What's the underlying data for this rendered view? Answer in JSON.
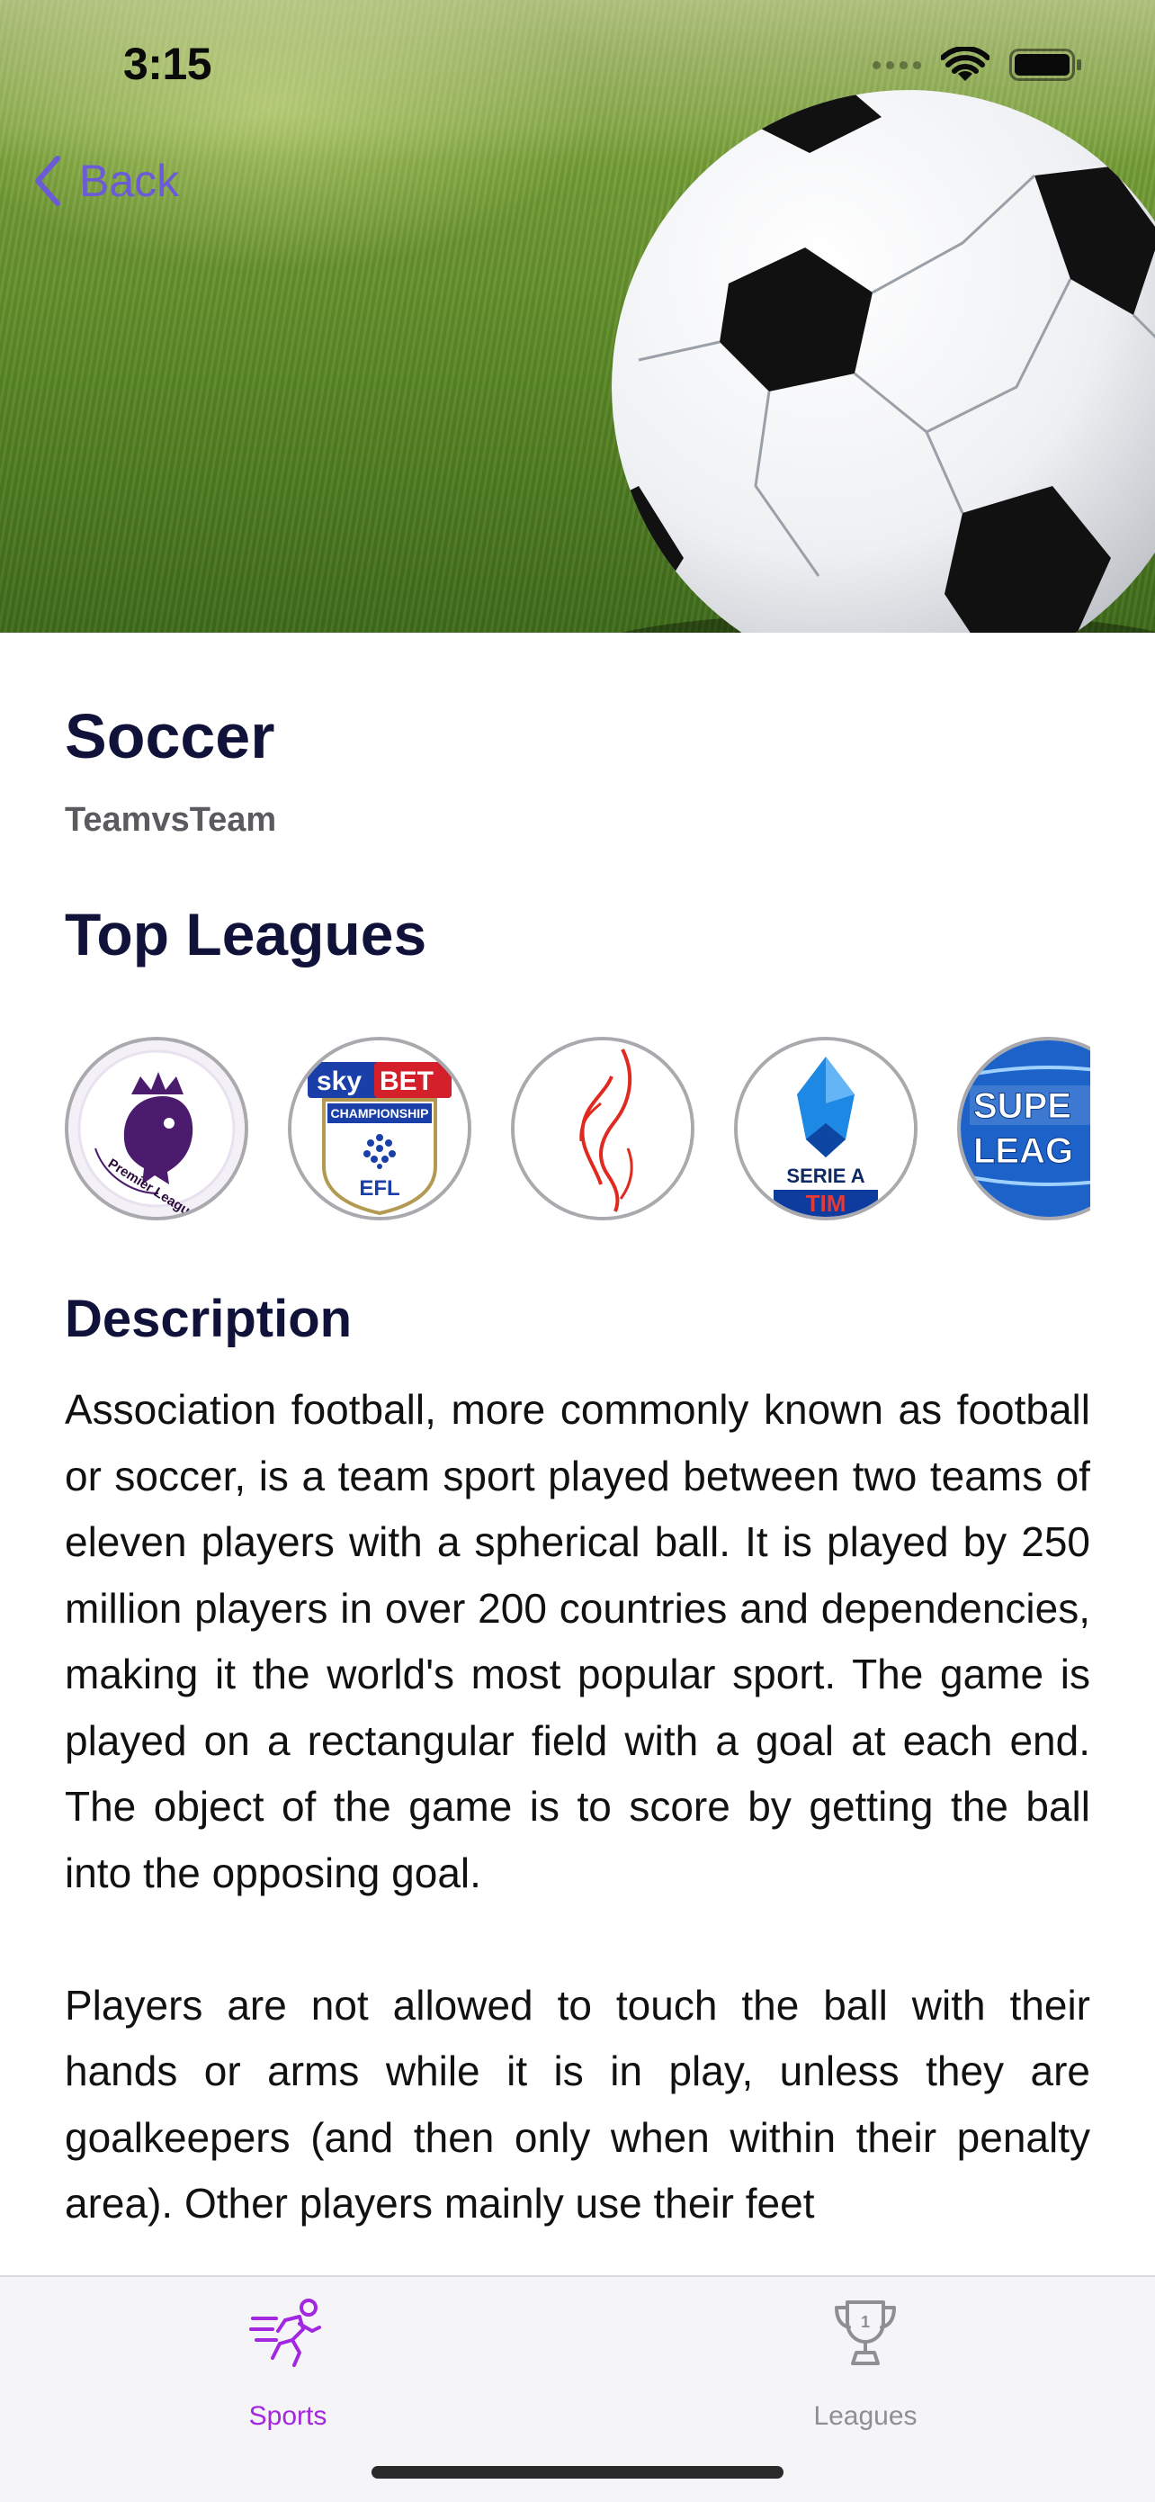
{
  "status_bar": {
    "time": "3:15"
  },
  "nav": {
    "back_label": "Back",
    "accent_color": "#6b5bd6"
  },
  "sport": {
    "name": "Soccer",
    "format": "TeamvsTeam"
  },
  "top_leagues": {
    "heading": "Top Leagues",
    "logos": [
      {
        "icon": "premier-league-logo",
        "text": "Premier League"
      },
      {
        "icon": "efl-championship-logo",
        "text": "sky BET CHAMPIONSHIP EFL"
      },
      {
        "icon": "flame-crest-logo",
        "text": ""
      },
      {
        "icon": "serie-a-logo",
        "text": "SERIE A TIM"
      },
      {
        "icon": "super-league-greece-logo",
        "text": "SUPE LEAG"
      }
    ]
  },
  "description": {
    "heading": "Description",
    "paragraphs": [
      "Association football, more commonly known as football or soccer, is a team sport played between two teams of eleven players with a spherical ball. It is played by 250 million players in over 200 countries and dependencies, making it the world's most popular sport. The game is played on a rectangular field with a goal at each end. The object of the game is to score by getting the ball into the opposing goal.",
      "Players are not allowed to touch the ball with their hands or arms while it is in play, unless they are goalkeepers (and then only when within their penalty area). Other players mainly use their feet"
    ]
  },
  "tab_bar": {
    "tabs": [
      {
        "label": "Sports",
        "icon": "runner-icon",
        "selected": true,
        "color": "#a326e0"
      },
      {
        "label": "Leagues",
        "icon": "trophy-icon",
        "selected": false,
        "color": "#8e8e93"
      }
    ]
  }
}
